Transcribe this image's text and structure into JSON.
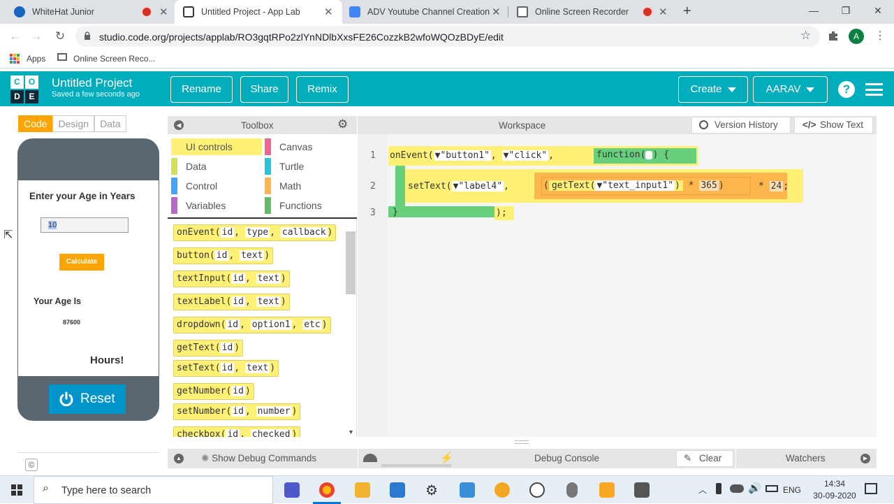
{
  "browser": {
    "tabs": [
      {
        "title": "WhiteHat Junior"
      },
      {
        "title": "Untitled Project - App Lab"
      },
      {
        "title": "ADV Youtube Channel Creation"
      },
      {
        "title": "Online Screen Recorder"
      }
    ],
    "url": "studio.code.org/projects/applab/RO3gqtRPo2zlYnNDlbXxsFE26CozzkB2wfoWQOzBDyE/edit",
    "avatar_letter": "A",
    "bookmarks": [
      "Apps",
      "Online Screen Reco..."
    ]
  },
  "header": {
    "logo": [
      "C",
      "O",
      "D",
      "E"
    ],
    "title": "Untitled Project",
    "subtitle": "Saved a few seconds ago",
    "rename": "Rename",
    "share": "Share",
    "remix": "Remix",
    "create": "Create",
    "user": "AARAV",
    "help": "?"
  },
  "modes": [
    "Code",
    "Design",
    "Data"
  ],
  "app": {
    "heading": "Enter your Age in Years",
    "input_value": "10",
    "calculate": "Calculate",
    "result_label": "Your Age Is",
    "result_value": "87600",
    "hours": "Hours!",
    "reset": "Reset",
    "copyright": "©"
  },
  "toolbox": {
    "title": "Toolbox",
    "categories": [
      {
        "label": "UI controls",
        "color": "#fff176"
      },
      {
        "label": "Canvas",
        "color": "#f06292"
      },
      {
        "label": "Data",
        "color": "#d4e157"
      },
      {
        "label": "Turtle",
        "color": "#26c6da"
      },
      {
        "label": "Control",
        "color": "#42a5f5"
      },
      {
        "label": "Math",
        "color": "#ffb74d"
      },
      {
        "label": "Variables",
        "color": "#ba68c8"
      },
      {
        "label": "Functions",
        "color": "#66bb6a"
      }
    ],
    "blocks": [
      {
        "name": "onEvent",
        "params": [
          "id",
          "type",
          "callback"
        ]
      },
      {
        "name": "button",
        "params": [
          "id",
          "text"
        ]
      },
      {
        "name": "textInput",
        "params": [
          "id",
          "text"
        ]
      },
      {
        "name": "textLabel",
        "params": [
          "id",
          "text"
        ]
      },
      {
        "name": "dropdown",
        "params": [
          "id",
          "option1",
          "etc"
        ]
      },
      {
        "name": "getText",
        "params": [
          "id"
        ]
      },
      {
        "name": "setText",
        "params": [
          "id",
          "text"
        ]
      },
      {
        "name": "getNumber",
        "params": [
          "id"
        ]
      },
      {
        "name": "setNumber",
        "params": [
          "id",
          "number"
        ]
      },
      {
        "name": "checkbox",
        "params": [
          "id",
          "checked"
        ]
      }
    ]
  },
  "workspace": {
    "title": "Workspace",
    "version_history": "Version History",
    "show_text": "Show Text",
    "line_numbers": [
      "1",
      "2",
      "3"
    ],
    "line1": {
      "fn": "onEvent",
      "arg1": "\"button1\"",
      "arg2": "\"click\"",
      "func": "function",
      "brace": "{"
    },
    "line2": {
      "fn": "setText",
      "arg1": "\"label4\"",
      "inner": "getText",
      "inner_arg": "\"text_input1\"",
      "mul1": "*",
      "n1": "365",
      "mul2": "*",
      "n2": "24",
      "end": ";"
    },
    "line3": {
      "text": "}",
      "end": ");"
    }
  },
  "debug": {
    "show_commands": "Show Debug Commands",
    "console": "Debug Console",
    "clear": "Clear",
    "watchers": "Watchers"
  },
  "taskbar": {
    "search_placeholder": "Type here to search",
    "lang": "ENG",
    "time": "14:34",
    "date": "30-09-2020"
  }
}
